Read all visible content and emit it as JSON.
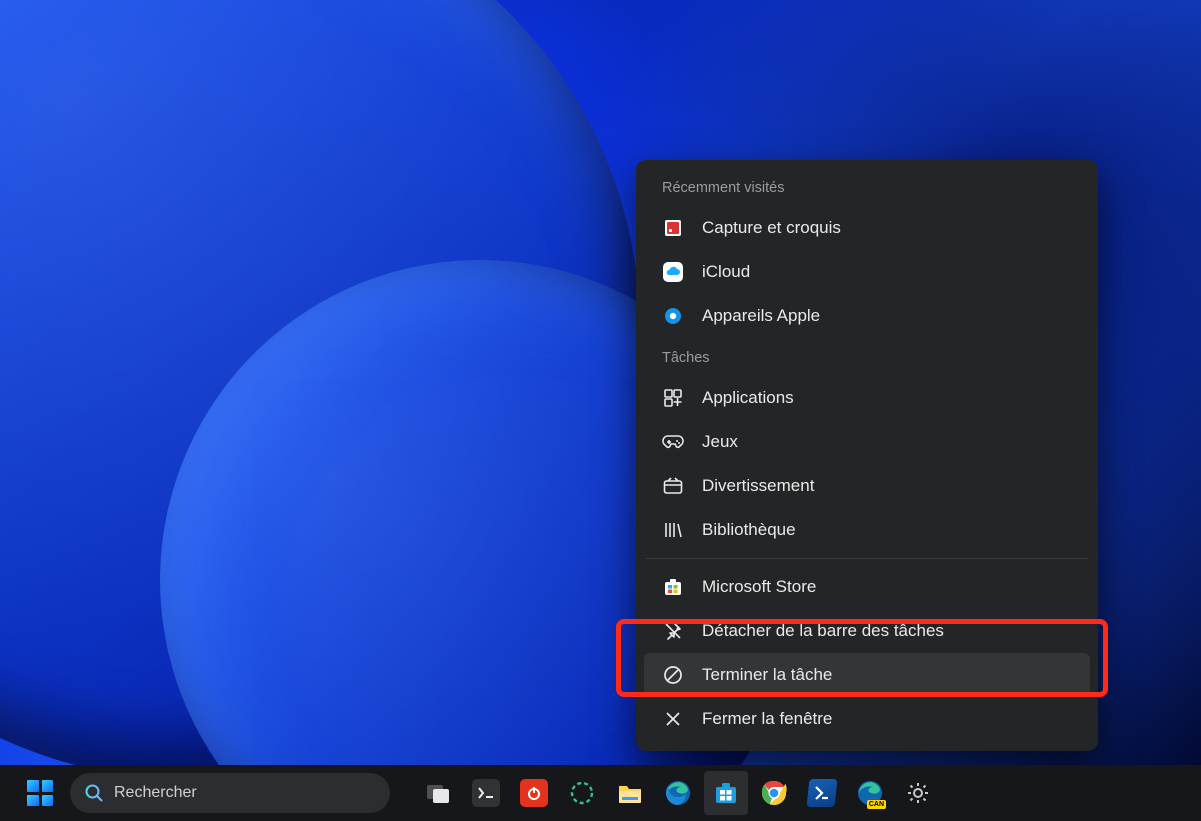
{
  "taskbar": {
    "search_placeholder": "Rechercher",
    "icons": [
      {
        "name": "task-view"
      },
      {
        "name": "terminal"
      },
      {
        "name": "power-automate"
      },
      {
        "name": "circle-dashed"
      },
      {
        "name": "file-explorer"
      },
      {
        "name": "edge"
      },
      {
        "name": "microsoft-store"
      },
      {
        "name": "chrome"
      },
      {
        "name": "powershell"
      },
      {
        "name": "edge-canary"
      },
      {
        "name": "settings"
      }
    ]
  },
  "jumplist": {
    "section_recent": "Récemment visités",
    "recent": [
      {
        "label": "Capture et croquis",
        "icon": "snip"
      },
      {
        "label": "iCloud",
        "icon": "icloud"
      },
      {
        "label": "Appareils Apple",
        "icon": "apple-devices"
      }
    ],
    "section_tasks": "Tâches",
    "tasks": [
      {
        "label": "Applications",
        "icon": "apps"
      },
      {
        "label": "Jeux",
        "icon": "games"
      },
      {
        "label": "Divertissement",
        "icon": "entertainment"
      },
      {
        "label": "Bibliothèque",
        "icon": "library"
      }
    ],
    "app_pin": {
      "label": "Microsoft Store",
      "icon": "ms-store"
    },
    "unpin": {
      "label": "Détacher de la barre des tâches"
    },
    "end_task": {
      "label": "Terminer la tâche"
    },
    "close_window": {
      "label": "Fermer la fenêtre"
    }
  }
}
